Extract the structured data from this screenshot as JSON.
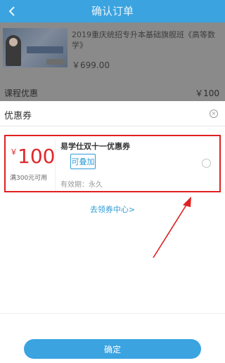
{
  "header": {
    "title": "确认订单",
    "back_icon": "chevron-left-icon"
  },
  "order": {
    "course_title": "2019重庆统招专升本基础旗舰班《高等数学》",
    "price": "￥699.00"
  },
  "discount": {
    "label": "课程优惠",
    "value": "￥100"
  },
  "coupon_sheet": {
    "title": "优惠券",
    "close_icon": "close-circle-icon",
    "coupon": {
      "currency": "￥",
      "amount": "100",
      "condition": "满300元可用",
      "name": "易学仕双十一优惠券",
      "stackable_label": "可叠加",
      "validity": "有效期：永久",
      "selected": false
    },
    "get_more_link": "去领券中心>",
    "confirm_button": "确定"
  },
  "colors": {
    "primary": "#3aa3e0",
    "price_red": "#e0282b",
    "annotation_red": "#e02020"
  }
}
